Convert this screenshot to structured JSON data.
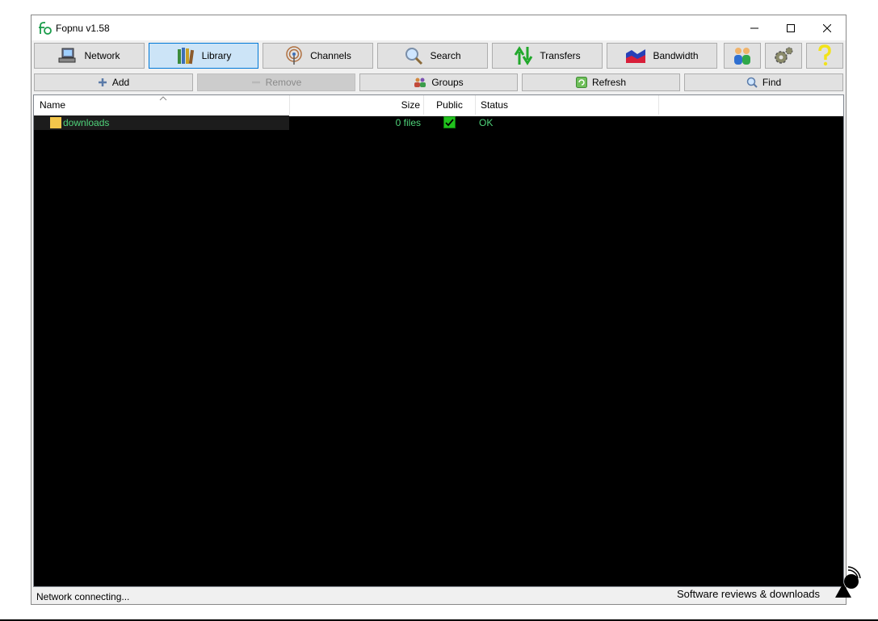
{
  "window": {
    "title": "Fopnu v1.58",
    "controls": {
      "minimize": "minimize-icon",
      "maximize": "maximize-icon",
      "close": "close-icon"
    }
  },
  "toolbar": {
    "network_label": "Network",
    "library_label": "Library",
    "channels_label": "Channels",
    "search_label": "Search",
    "transfers_label": "Transfers",
    "bandwidth_label": "Bandwidth",
    "active_tab": "Library",
    "extra_icons": [
      "users-icon",
      "gear-icon",
      "help-icon"
    ]
  },
  "subtoolbar": {
    "add_label": "Add",
    "remove_label": "Remove",
    "groups_label": "Groups",
    "refresh_label": "Refresh",
    "find_label": "Find"
  },
  "table": {
    "columns": {
      "name": "Name",
      "size": "Size",
      "public": "Public",
      "status": "Status"
    },
    "sort_indicator": "^",
    "rows": [
      {
        "name": "downloads",
        "size": "0 files",
        "public": true,
        "status": "OK"
      }
    ]
  },
  "statusbar": {
    "text": "Network connecting..."
  },
  "watermark": {
    "text": "Software reviews & downloads"
  },
  "colors": {
    "list_background": "#000000",
    "row_text": "#4fd37a",
    "active_tab_bg": "#cce4f7",
    "active_tab_border": "#0078d7",
    "check_green": "#21c21d"
  }
}
